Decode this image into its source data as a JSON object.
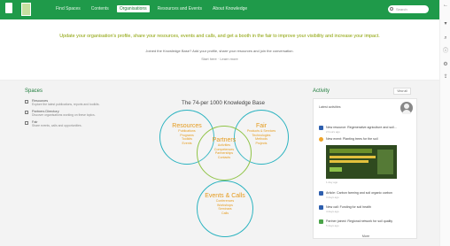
{
  "nav": {
    "items": [
      {
        "label": "Find Spaces",
        "active": false
      },
      {
        "label": "Contents",
        "active": false
      },
      {
        "label": "Organisations",
        "active": true
      },
      {
        "label": "Resources and Events",
        "active": false
      },
      {
        "label": "About Knowledge",
        "active": false
      }
    ],
    "search_placeholder": "Search"
  },
  "hero": {
    "headline": "Update your organisation's profile, share your resources, events and calls, and get a booth in the fair to improve your visibility and increase your impact.",
    "sub": "Joined the Knowledge Base? Add your profile, share your resources and join the conversation.",
    "sub2": "Start here · Learn more"
  },
  "spaces": {
    "title": "Spaces",
    "items": [
      {
        "title": "Resources",
        "desc": "Explore the latest publications, reports and toolkits."
      },
      {
        "title": "Partners Directory",
        "desc": "Discover organisations working on these topics."
      },
      {
        "title": "Fair",
        "desc": "Share events, calls and opportunities."
      }
    ]
  },
  "diagram": {
    "title": "The 74-per 1000 Knowledge Base",
    "circles": {
      "resources": {
        "head": "Resources",
        "lines": [
          "Publications",
          "Programs",
          "Toolkits",
          "Events"
        ]
      },
      "fair": {
        "head": "Fair",
        "lines": [
          "Products & Services",
          "Technologies",
          "Methods",
          "Projects"
        ]
      },
      "partners": {
        "head": "Partners",
        "lines": [
          "Activities",
          "Competences",
          "Partnerships",
          "Contacts"
        ]
      },
      "events": {
        "head": "Events & Calls",
        "lines": [
          "Conferences",
          "Workshops",
          "Seminars",
          "Calls"
        ]
      }
    }
  },
  "activity": {
    "title": "Activity",
    "button": "View all",
    "head": "Latest activities",
    "items": [
      {
        "text": "New resource: Regenerative agriculture and soil...",
        "meta": "2 hours ago",
        "icon": "document"
      },
      {
        "text": "New event: Planting trees for the soil",
        "meta": "1 day ago",
        "icon": "event"
      },
      {
        "text": "Article: Carbon farming and soil organic carbon",
        "meta": "3 days ago",
        "icon": "document"
      },
      {
        "text": "New call: Funding for soil health",
        "meta": "4 days ago",
        "icon": "document"
      },
      {
        "text": "Partner joined: Regional network for soil quality",
        "meta": "5 days ago",
        "icon": "partner"
      }
    ],
    "promo_caption": "Soil health event promotion",
    "more": "More"
  },
  "colors": {
    "nav": "#1f9a4a",
    "accent_orange": "#e59a1b",
    "ring": "#2bb3c0"
  }
}
